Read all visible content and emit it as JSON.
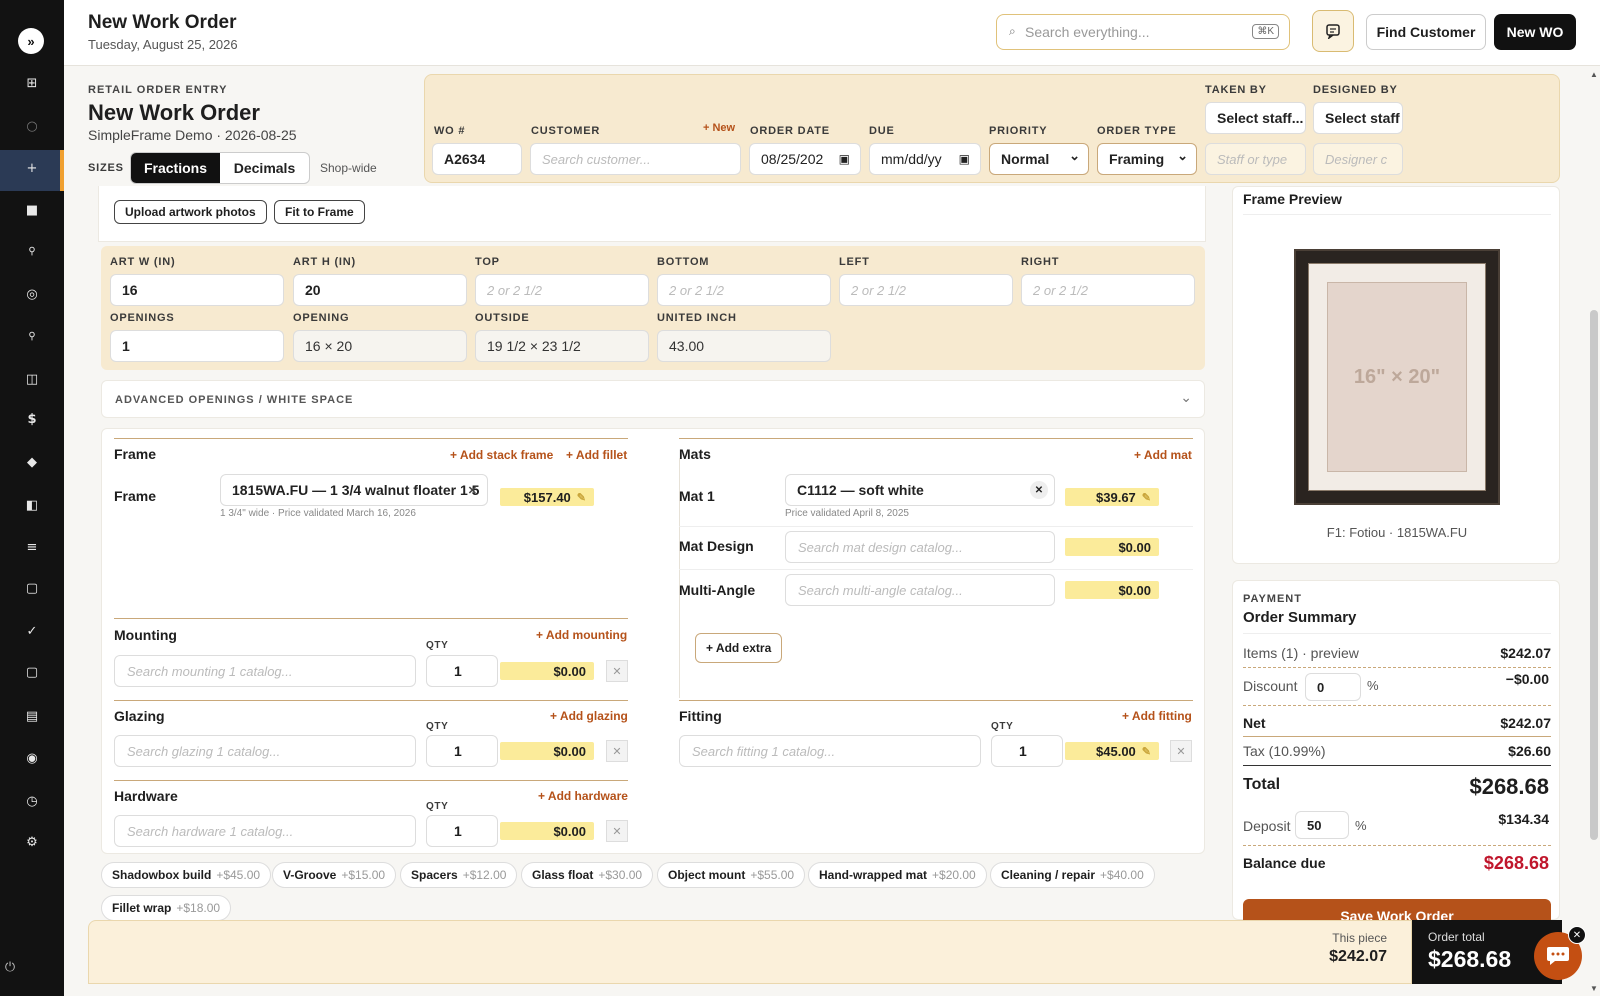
{
  "header": {
    "title": "New Work Order",
    "date": "Tuesday, August 25, 2026",
    "search_placeholder": "Search everything...",
    "search_shortcut": "⌘K",
    "find_customer": "Find Customer",
    "new_wo": "New WO"
  },
  "entry": {
    "eyebrow": "RETAIL ORDER ENTRY",
    "title": "New Work Order",
    "subtitle": "SimpleFrame Demo · 2026-08-25",
    "sizes_label": "SIZES",
    "size_modes": [
      "Fractions",
      "Decimals"
    ],
    "active_mode": "Fractions",
    "shop_wide": "Shop-wide"
  },
  "order": {
    "wo_label": "WO #",
    "wo_value": "A2634",
    "customer_label": "CUSTOMER",
    "customer_new": "+ New",
    "customer_placeholder": "Search customer...",
    "order_date_label": "ORDER DATE",
    "order_date_value": "08/25/202",
    "due_label": "DUE",
    "due_value": "mm/dd/yy",
    "priority_label": "PRIORITY",
    "priority_value": "Normal",
    "order_type_label": "ORDER TYPE",
    "order_type_value": "Framing",
    "taken_by_label": "TAKEN BY",
    "taken_by_select": "Select staff...",
    "taken_by_placeholder": "Staff or type",
    "designed_by_label": "DESIGNED BY",
    "designed_by_select": "Select staff",
    "designed_by_placeholder": "Designer c"
  },
  "artwork": {
    "upload": "Upload artwork photos",
    "fit": "Fit to Frame"
  },
  "dims": {
    "art_w_label": "ART W (IN)",
    "art_w": "16",
    "art_h_label": "ART H (IN)",
    "art_h": "20",
    "top_label": "TOP",
    "bottom_label": "BOTTOM",
    "left_label": "LEFT",
    "right_label": "RIGHT",
    "margin_placeholder": "2 or 2 1/2",
    "openings_label": "OPENINGS",
    "openings": "1",
    "opening_label": "OPENING",
    "opening": "16 × 20",
    "outside_label": "OUTSIDE",
    "outside": "19 1/2 × 23 1/2",
    "united_label": "UNITED INCH",
    "united": "43.00"
  },
  "advanced": "ADVANCED OPENINGS / WHITE SPACE",
  "frame": {
    "title": "Frame",
    "add_stack": "+ Add stack frame",
    "add_fillet": "+ Add fillet",
    "row_label": "Frame",
    "value": "1815WA.FU — 1 3/4 walnut floater 1 5",
    "note": "1 3/4\" wide · Price validated March 16, 2026",
    "price": "$157.40"
  },
  "mats": {
    "title": "Mats",
    "add": "+ Add mat",
    "mat1_label": "Mat 1",
    "mat1_value": "C1112 — soft white",
    "mat1_note": "Price validated April 8, 2025",
    "mat1_price": "$39.67",
    "design_label": "Mat Design",
    "design_placeholder": "Search mat design catalog...",
    "design_price": "$0.00",
    "multi_label": "Multi-Angle",
    "multi_placeholder": "Search multi-angle catalog...",
    "multi_price": "$0.00",
    "add_extra": "+ Add extra"
  },
  "mounting": {
    "title": "Mounting",
    "add": "+ Add mounting",
    "qty_label": "QTY",
    "placeholder": "Search mounting 1 catalog...",
    "qty": "1",
    "price": "$0.00"
  },
  "glazing": {
    "title": "Glazing",
    "add": "+ Add glazing",
    "qty_label": "QTY",
    "placeholder": "Search glazing 1 catalog...",
    "qty": "1",
    "price": "$0.00"
  },
  "hardware": {
    "title": "Hardware",
    "add": "+ Add hardware",
    "qty_label": "QTY",
    "placeholder": "Search hardware 1 catalog...",
    "qty": "1",
    "price": "$0.00"
  },
  "fitting": {
    "title": "Fitting",
    "add": "+ Add fitting",
    "qty_label": "QTY",
    "placeholder": "Search fitting 1 catalog...",
    "qty": "1",
    "price": "$45.00"
  },
  "chips": [
    {
      "name": "Shadowbox build",
      "price": "+$45.00"
    },
    {
      "name": "V-Groove",
      "price": "+$15.00"
    },
    {
      "name": "Spacers",
      "price": "+$12.00"
    },
    {
      "name": "Glass float",
      "price": "+$30.00"
    },
    {
      "name": "Object mount",
      "price": "+$55.00"
    },
    {
      "name": "Hand-wrapped mat",
      "price": "+$20.00"
    },
    {
      "name": "Cleaning / repair",
      "price": "+$40.00"
    },
    {
      "name": "Fillet wrap",
      "price": "+$18.00"
    }
  ],
  "preview": {
    "title": "Frame Preview",
    "size": "16\" × 20\"",
    "caption": "F1: Fotiou · 1815WA.FU"
  },
  "summary": {
    "eyebrow": "PAYMENT",
    "title": "Order Summary",
    "items_label": "Items (1) · preview",
    "items": "$242.07",
    "discount_label": "Discount",
    "discount_input": "0",
    "discount_pct": "%",
    "discount": "−$0.00",
    "net_label": "Net",
    "net": "$242.07",
    "tax_label": "Tax (10.99%)",
    "tax": "$26.60",
    "total_label": "Total",
    "total": "$268.68",
    "deposit_label": "Deposit",
    "deposit_input": "50",
    "deposit_pct": "%",
    "deposit": "$134.34",
    "balance_label": "Balance due",
    "balance": "$268.68",
    "save": "Save Work Order"
  },
  "bottom": {
    "piece_label": "This piece",
    "piece": "$242.07",
    "order_label": "Order total",
    "order": "$268.68"
  },
  "colors": {
    "accent": "#b5521a",
    "panel": "#f7ead0",
    "highlight": "#fbeb9a",
    "balance": "#c0162c"
  }
}
